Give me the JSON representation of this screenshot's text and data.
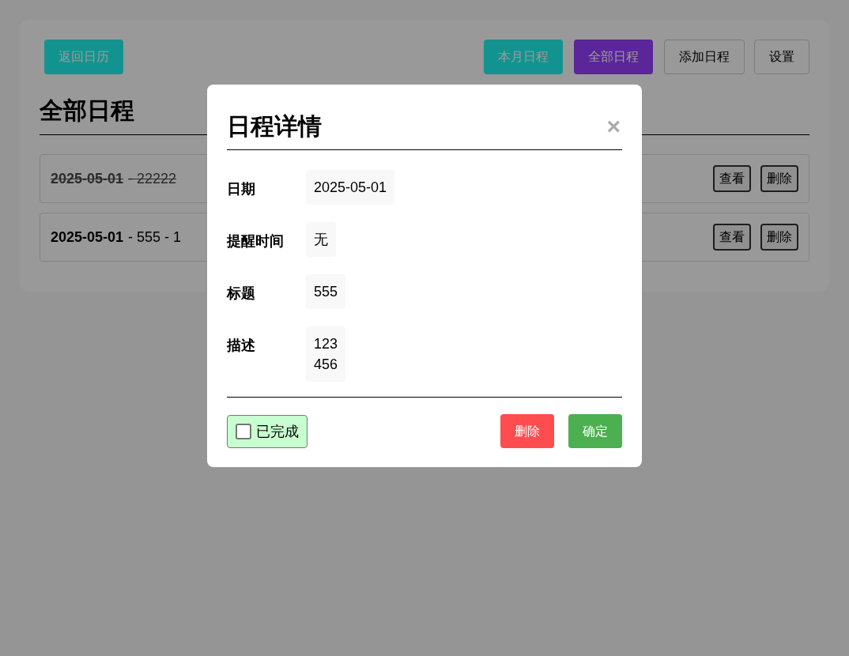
{
  "toolbar": {
    "back": "返回日历",
    "tabs": [
      {
        "label": "本月日程",
        "selected": false
      },
      {
        "label": "全部日程",
        "selected": true
      }
    ],
    "buttons": [
      "添加日程",
      "设置"
    ]
  },
  "page_title": "全部日程",
  "events": [
    {
      "date": "2025-05-01",
      "text": "- 22222",
      "completed": true,
      "actions": [
        "查看",
        "删除"
      ]
    },
    {
      "date": "2025-05-01",
      "text": "- 555 - 1",
      "completed": false,
      "actions": [
        "查看",
        "删除"
      ]
    }
  ],
  "dialog": {
    "title": "日程详情",
    "close": "×",
    "fields": [
      {
        "label": "日期",
        "value": "2025-05-01"
      },
      {
        "label": "提醒时间",
        "value": "无"
      },
      {
        "label": "标题",
        "value": "555"
      },
      {
        "label": "描述",
        "value": "123\n456"
      }
    ],
    "completed": {
      "label": "已完成",
      "checked": false
    },
    "delete": "删除",
    "confirm": "确定"
  }
}
